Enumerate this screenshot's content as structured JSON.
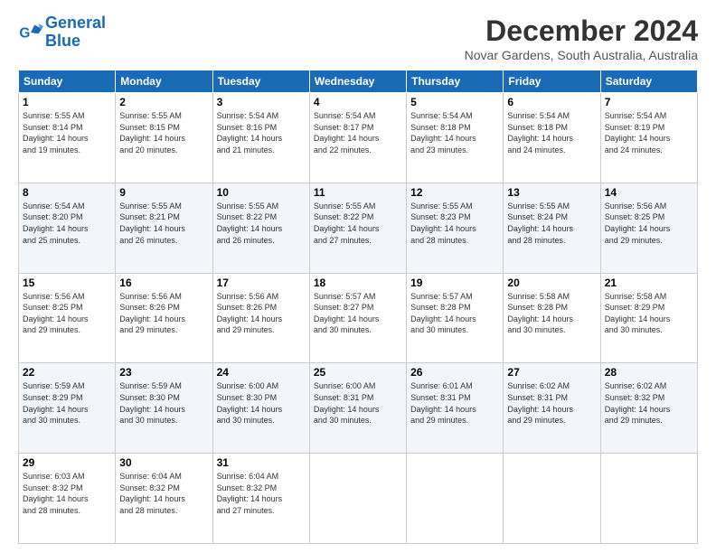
{
  "logo": {
    "line1": "General",
    "line2": "Blue"
  },
  "title": "December 2024",
  "subtitle": "Novar Gardens, South Australia, Australia",
  "days_of_week": [
    "Sunday",
    "Monday",
    "Tuesday",
    "Wednesday",
    "Thursday",
    "Friday",
    "Saturday"
  ],
  "weeks": [
    [
      {
        "day": "1",
        "info": "Sunrise: 5:55 AM\nSunset: 8:14 PM\nDaylight: 14 hours\nand 19 minutes."
      },
      {
        "day": "2",
        "info": "Sunrise: 5:55 AM\nSunset: 8:15 PM\nDaylight: 14 hours\nand 20 minutes."
      },
      {
        "day": "3",
        "info": "Sunrise: 5:54 AM\nSunset: 8:16 PM\nDaylight: 14 hours\nand 21 minutes."
      },
      {
        "day": "4",
        "info": "Sunrise: 5:54 AM\nSunset: 8:17 PM\nDaylight: 14 hours\nand 22 minutes."
      },
      {
        "day": "5",
        "info": "Sunrise: 5:54 AM\nSunset: 8:18 PM\nDaylight: 14 hours\nand 23 minutes."
      },
      {
        "day": "6",
        "info": "Sunrise: 5:54 AM\nSunset: 8:18 PM\nDaylight: 14 hours\nand 24 minutes."
      },
      {
        "day": "7",
        "info": "Sunrise: 5:54 AM\nSunset: 8:19 PM\nDaylight: 14 hours\nand 24 minutes."
      }
    ],
    [
      {
        "day": "8",
        "info": "Sunrise: 5:54 AM\nSunset: 8:20 PM\nDaylight: 14 hours\nand 25 minutes."
      },
      {
        "day": "9",
        "info": "Sunrise: 5:55 AM\nSunset: 8:21 PM\nDaylight: 14 hours\nand 26 minutes."
      },
      {
        "day": "10",
        "info": "Sunrise: 5:55 AM\nSunset: 8:22 PM\nDaylight: 14 hours\nand 26 minutes."
      },
      {
        "day": "11",
        "info": "Sunrise: 5:55 AM\nSunset: 8:22 PM\nDaylight: 14 hours\nand 27 minutes."
      },
      {
        "day": "12",
        "info": "Sunrise: 5:55 AM\nSunset: 8:23 PM\nDaylight: 14 hours\nand 28 minutes."
      },
      {
        "day": "13",
        "info": "Sunrise: 5:55 AM\nSunset: 8:24 PM\nDaylight: 14 hours\nand 28 minutes."
      },
      {
        "day": "14",
        "info": "Sunrise: 5:56 AM\nSunset: 8:25 PM\nDaylight: 14 hours\nand 29 minutes."
      }
    ],
    [
      {
        "day": "15",
        "info": "Sunrise: 5:56 AM\nSunset: 8:25 PM\nDaylight: 14 hours\nand 29 minutes."
      },
      {
        "day": "16",
        "info": "Sunrise: 5:56 AM\nSunset: 8:26 PM\nDaylight: 14 hours\nand 29 minutes."
      },
      {
        "day": "17",
        "info": "Sunrise: 5:56 AM\nSunset: 8:26 PM\nDaylight: 14 hours\nand 29 minutes."
      },
      {
        "day": "18",
        "info": "Sunrise: 5:57 AM\nSunset: 8:27 PM\nDaylight: 14 hours\nand 30 minutes."
      },
      {
        "day": "19",
        "info": "Sunrise: 5:57 AM\nSunset: 8:28 PM\nDaylight: 14 hours\nand 30 minutes."
      },
      {
        "day": "20",
        "info": "Sunrise: 5:58 AM\nSunset: 8:28 PM\nDaylight: 14 hours\nand 30 minutes."
      },
      {
        "day": "21",
        "info": "Sunrise: 5:58 AM\nSunset: 8:29 PM\nDaylight: 14 hours\nand 30 minutes."
      }
    ],
    [
      {
        "day": "22",
        "info": "Sunrise: 5:59 AM\nSunset: 8:29 PM\nDaylight: 14 hours\nand 30 minutes."
      },
      {
        "day": "23",
        "info": "Sunrise: 5:59 AM\nSunset: 8:30 PM\nDaylight: 14 hours\nand 30 minutes."
      },
      {
        "day": "24",
        "info": "Sunrise: 6:00 AM\nSunset: 8:30 PM\nDaylight: 14 hours\nand 30 minutes."
      },
      {
        "day": "25",
        "info": "Sunrise: 6:00 AM\nSunset: 8:31 PM\nDaylight: 14 hours\nand 30 minutes."
      },
      {
        "day": "26",
        "info": "Sunrise: 6:01 AM\nSunset: 8:31 PM\nDaylight: 14 hours\nand 29 minutes."
      },
      {
        "day": "27",
        "info": "Sunrise: 6:02 AM\nSunset: 8:31 PM\nDaylight: 14 hours\nand 29 minutes."
      },
      {
        "day": "28",
        "info": "Sunrise: 6:02 AM\nSunset: 8:32 PM\nDaylight: 14 hours\nand 29 minutes."
      }
    ],
    [
      {
        "day": "29",
        "info": "Sunrise: 6:03 AM\nSunset: 8:32 PM\nDaylight: 14 hours\nand 28 minutes."
      },
      {
        "day": "30",
        "info": "Sunrise: 6:04 AM\nSunset: 8:32 PM\nDaylight: 14 hours\nand 28 minutes."
      },
      {
        "day": "31",
        "info": "Sunrise: 6:04 AM\nSunset: 8:32 PM\nDaylight: 14 hours\nand 27 minutes."
      },
      null,
      null,
      null,
      null
    ]
  ]
}
